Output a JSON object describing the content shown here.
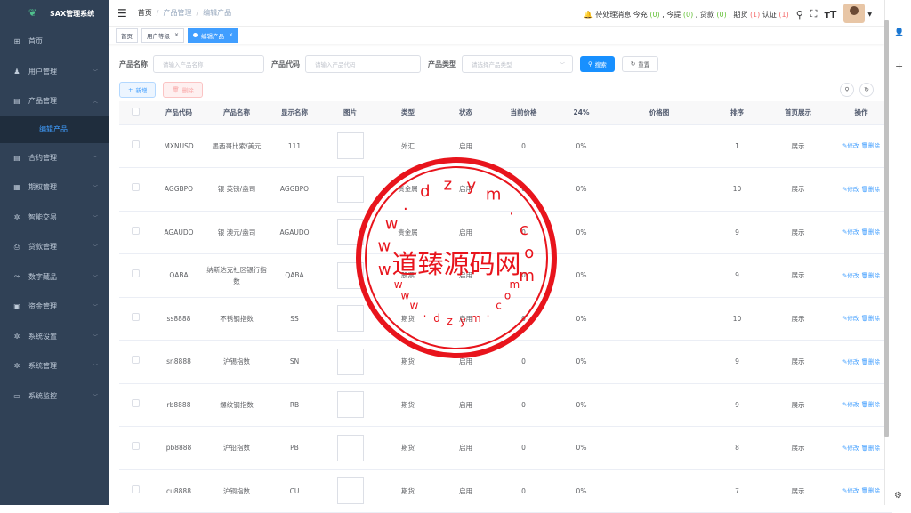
{
  "app": {
    "title": "SAX管理系统"
  },
  "sidebar": {
    "items": [
      {
        "label": "首页",
        "icon": "dashboard-icon"
      },
      {
        "label": "用户管理",
        "icon": "user-icon"
      },
      {
        "label": "产品管理",
        "icon": "document-icon"
      },
      {
        "label": "合约管理",
        "icon": "document-icon"
      },
      {
        "label": "期权管理",
        "icon": "chart-icon"
      },
      {
        "label": "智能交易",
        "icon": "gear-icon"
      },
      {
        "label": "贷款管理",
        "icon": "printer-icon"
      },
      {
        "label": "数字藏品",
        "icon": "trend-icon"
      },
      {
        "label": "资金管理",
        "icon": "money-icon"
      },
      {
        "label": "系统设置",
        "icon": "gear-icon"
      },
      {
        "label": "系统管理",
        "icon": "gear-icon"
      },
      {
        "label": "系统监控",
        "icon": "monitor-icon"
      }
    ],
    "sub_active": "编辑产品"
  },
  "breadcrumb": [
    "首页",
    "产品管理",
    "编辑产品"
  ],
  "navbar": {
    "notice_label": "待处理消息",
    "today_charge_label": "今充",
    "today_charge": "(0)",
    "today_withdraw_label": "今提",
    "today_withdraw": "(0)",
    "loan_label": "贷款",
    "loan": "(0)",
    "futures_label": "期货",
    "futures": "(1)",
    "auth_label": "认证",
    "auth": "(1)",
    "sep": ","
  },
  "tags": [
    {
      "label": "首页"
    },
    {
      "label": "用户等级"
    },
    {
      "label": "编辑产品"
    }
  ],
  "search": {
    "name_label": "产品名称",
    "name_placeholder": "请输入产品名称",
    "code_label": "产品代码",
    "code_placeholder": "请输入产品代码",
    "type_label": "产品类型",
    "type_placeholder": "请选择产品类型",
    "search_btn": "搜索",
    "reset_btn": "重置"
  },
  "toolbar": {
    "add_btn": "新增",
    "delete_btn": "删除"
  },
  "table": {
    "headers": [
      "产品代码",
      "产品名称",
      "显示名称",
      "图片",
      "类型",
      "状态",
      "当前价格",
      "24%",
      "价格图",
      "排序",
      "首页展示",
      "操作"
    ],
    "edit_label": "修改",
    "delete_label": "删除",
    "rows": [
      {
        "code": "MXNUSD",
        "name": "墨西哥比索/美元",
        "display": "111",
        "type": "外汇",
        "status": "启用",
        "price": "0",
        "pct": "0%",
        "sort": "1",
        "home": "展示"
      },
      {
        "code": "AGGBPO",
        "name": "银 英镑/盎司",
        "display": "AGGBPO",
        "type": "贵金属",
        "status": "启用",
        "price": "0",
        "pct": "0%",
        "sort": "10",
        "home": "展示"
      },
      {
        "code": "AGAUDO",
        "name": "银 澳元/盎司",
        "display": "AGAUDO",
        "type": "贵金属",
        "status": "启用",
        "price": "0",
        "pct": "0%",
        "sort": "9",
        "home": "展示"
      },
      {
        "code": "QABA",
        "name": "纳斯达克社区银行指数",
        "display": "QABA",
        "type": "股票",
        "status": "启用",
        "price": "0",
        "pct": "0%",
        "sort": "9",
        "home": "展示"
      },
      {
        "code": "ss8888",
        "name": "不锈钢指数",
        "display": "SS",
        "type": "期货",
        "status": "启用",
        "price": "0",
        "pct": "0%",
        "sort": "10",
        "home": "展示"
      },
      {
        "code": "sn8888",
        "name": "沪锡指数",
        "display": "SN",
        "type": "期货",
        "status": "启用",
        "price": "0",
        "pct": "0%",
        "sort": "9",
        "home": "展示"
      },
      {
        "code": "rb8888",
        "name": "螺纹钢指数",
        "display": "RB",
        "type": "期货",
        "status": "启用",
        "price": "0",
        "pct": "0%",
        "sort": "9",
        "home": "展示"
      },
      {
        "code": "pb8888",
        "name": "沪铅指数",
        "display": "PB",
        "type": "期货",
        "status": "启用",
        "price": "0",
        "pct": "0%",
        "sort": "8",
        "home": "展示"
      },
      {
        "code": "cu8888",
        "name": "沪铜指数",
        "display": "CU",
        "type": "期货",
        "status": "启用",
        "price": "0",
        "pct": "0%",
        "sort": "7",
        "home": "展示"
      }
    ]
  },
  "watermark": {
    "center": "道臻源码网",
    "ring": "www.dzym.com",
    "color": "#e8141c"
  }
}
